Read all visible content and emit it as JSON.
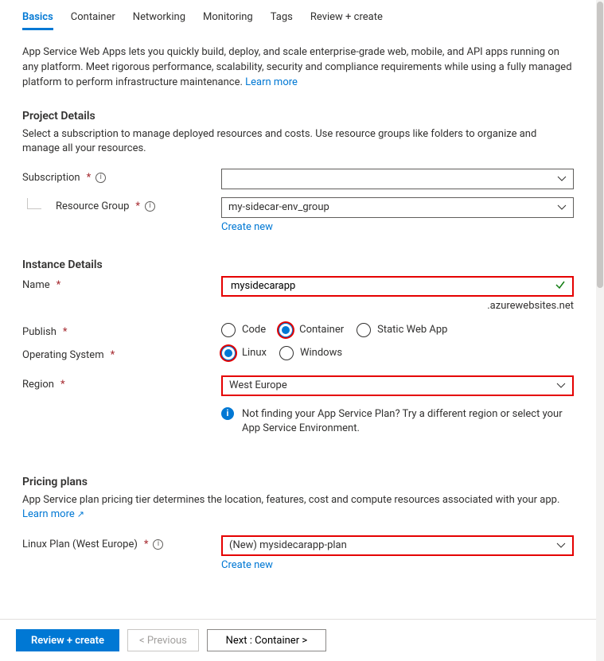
{
  "tabs": [
    "Basics",
    "Container",
    "Networking",
    "Monitoring",
    "Tags",
    "Review + create"
  ],
  "activeTab": "Basics",
  "intro": {
    "text": "App Service Web Apps lets you quickly build, deploy, and scale enterprise-grade web, mobile, and API apps running on any platform. Meet rigorous performance, scalability, security and compliance requirements while using a fully managed platform to perform infrastructure maintenance.  ",
    "learnMore": "Learn more"
  },
  "projectDetails": {
    "heading": "Project Details",
    "desc": "Select a subscription to manage deployed resources and costs. Use resource groups like folders to organize and manage all your resources.",
    "subscription": {
      "label": "Subscription",
      "value": ""
    },
    "resourceGroup": {
      "label": "Resource Group",
      "value": "my-sidecar-env_group",
      "createNew": "Create new"
    }
  },
  "instanceDetails": {
    "heading": "Instance Details",
    "name": {
      "label": "Name",
      "value": "mysidecarapp",
      "suffix": ".azurewebsites.net"
    },
    "publish": {
      "label": "Publish",
      "options": [
        "Code",
        "Container",
        "Static Web App"
      ],
      "selected": "Container"
    },
    "os": {
      "label": "Operating System",
      "options": [
        "Linux",
        "Windows"
      ],
      "selected": "Linux"
    },
    "region": {
      "label": "Region",
      "value": "West Europe",
      "hint": "Not finding your App Service Plan? Try a different region or select your App Service Environment."
    }
  },
  "pricing": {
    "heading": "Pricing plans",
    "desc": "App Service plan pricing tier determines the location, features, cost and compute resources associated with your app. ",
    "learnMore": "Learn more",
    "plan": {
      "label": "Linux Plan (West Europe)",
      "value": "(New) mysidecarapp-plan",
      "createNew": "Create new"
    }
  },
  "footer": {
    "review": "Review + create",
    "previous": "< Previous",
    "next": "Next : Container >"
  }
}
